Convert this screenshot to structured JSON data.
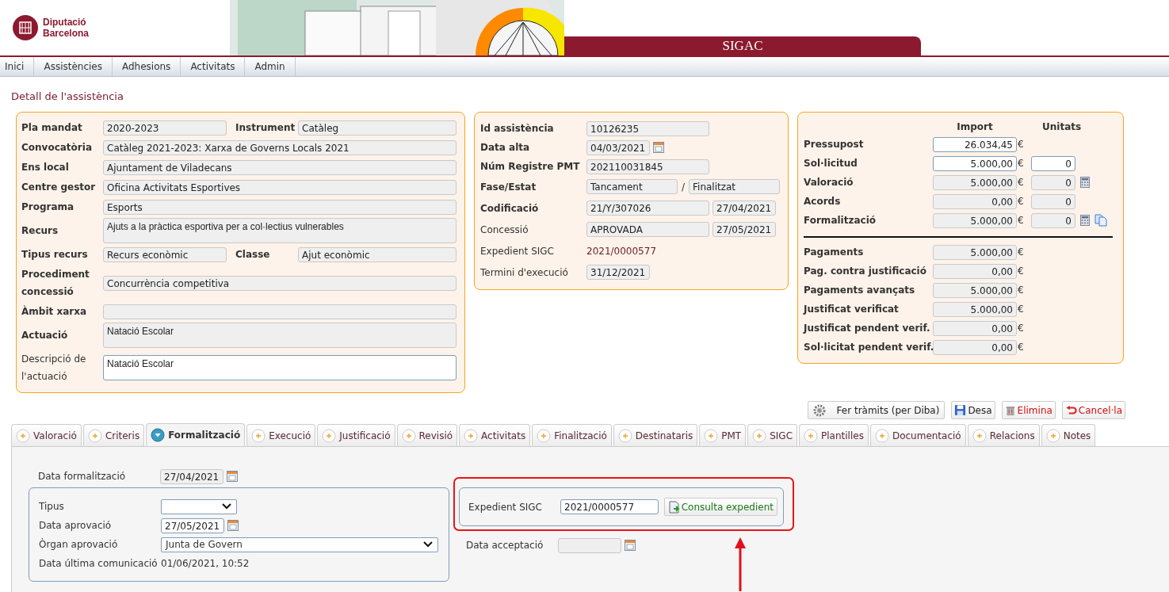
{
  "header": {
    "logo_lines": [
      "Diputació",
      "Barcelona"
    ],
    "app_title": "SIGAC"
  },
  "nav": [
    {
      "label": "Inici"
    },
    {
      "label": "Assistències"
    },
    {
      "label": "Adhesions"
    },
    {
      "label": "Activitats"
    },
    {
      "label": "Admin"
    }
  ],
  "page_title": "Detall de l'assistència",
  "general": [
    {
      "kind": "pair",
      "label": "Pla mandat",
      "bold": true,
      "value": "2020-2023",
      "label2": "Instrument",
      "value2": "Catàleg"
    },
    {
      "kind": "single",
      "label": "Convocatòria",
      "bold": true,
      "value": "Catàleg 2021-2023: Xarxa de Governs Locals 2021",
      "editable": false
    },
    {
      "kind": "single",
      "label": "Ens local",
      "bold": true,
      "value": "Ajuntament de Viladecans",
      "editable": false
    },
    {
      "kind": "single",
      "label": "Centre gestor",
      "bold": true,
      "value": "Oficina Activitats Esportives",
      "editable": false
    },
    {
      "kind": "single",
      "label": "Programa",
      "bold": true,
      "value": "Esports",
      "editable": false
    },
    {
      "kind": "textarea",
      "label": "Recurs",
      "bold": true,
      "value": "Ajuts a la pràctica esportiva per a col·lectius vulnerables",
      "editable": false
    },
    {
      "kind": "pair",
      "label": "Tipus recurs",
      "bold": true,
      "value": "Recurs econòmic",
      "label2": "Classe",
      "value2": "Ajut econòmic"
    },
    {
      "kind": "single",
      "label": "Procediment concessió",
      "bold": true,
      "value": "Concurrència competitiva",
      "editable": false
    },
    {
      "kind": "single",
      "label": "Àmbit xarxa",
      "bold": true,
      "editable": false
    },
    {
      "kind": "textarea",
      "label": "Actuació",
      "bold": true,
      "value": "Natació Escolar",
      "editable": false
    },
    {
      "kind": "textarea",
      "label": "Descripció de l'actuació",
      "bold": false,
      "value": "Natació Escolar",
      "editable": true
    }
  ],
  "identification": [
    {
      "kind": "field",
      "label": "Id assistència",
      "bold": true,
      "value": "10126235"
    },
    {
      "kind": "date",
      "label": "Data alta",
      "bold": true,
      "value": "04/03/2021"
    },
    {
      "kind": "field",
      "label": "Núm Registre PMT",
      "bold": true,
      "value": "202110031845"
    },
    {
      "kind": "slash",
      "label": "Fase/Estat",
      "bold": true,
      "value": "Tancament",
      "separator": "/",
      "value2": "Finalitzat"
    },
    {
      "kind": "pair",
      "label": "Codificació",
      "bold": true,
      "value": "21/Y/307026",
      "value2": "27/04/2021"
    },
    {
      "kind": "pair",
      "label": "Concessió",
      "bold": false,
      "value": "APROVADA",
      "value2": "27/05/2021"
    },
    {
      "kind": "text",
      "label": "Expedient SIGC",
      "bold": false,
      "value": "2021/0000577"
    },
    {
      "kind": "short",
      "label": "Termini d'execució",
      "bold": false,
      "value": "31/12/2021"
    }
  ],
  "amounts": {
    "headers": [
      "Import",
      "Unitats"
    ],
    "currency": "€",
    "rows": [
      {
        "label": "Pressupost",
        "import": "26.034,45",
        "import_editable": true
      },
      {
        "label": "Sol·licitud",
        "import": "5.000,00",
        "import_editable": true,
        "units": "0",
        "units_editable": true
      },
      {
        "label": "Valoració",
        "import": "5.000,00",
        "import_editable": false,
        "units": "0",
        "units_editable": false,
        "calculator": true
      },
      {
        "label": "Acords",
        "import": "0,00",
        "import_editable": false,
        "units": "0",
        "units_editable": false
      },
      {
        "label": "Formalització",
        "import": "5.000,00",
        "import_editable": false,
        "units": "0",
        "units_editable": false,
        "calculator": true,
        "copy": true
      }
    ],
    "payments": [
      {
        "label": "Pagaments",
        "import": "5.000,00"
      },
      {
        "label": "Pag. contra justificació",
        "import": "0,00"
      },
      {
        "label": "Pagaments avançats",
        "import": "5.000,00"
      },
      {
        "label": "Justificat verificat",
        "import": "5.000,00"
      },
      {
        "label": "Justificat pendent verif.",
        "import": "0,00"
      },
      {
        "label": "Sol·licitat pendent verif.",
        "import": "0,00"
      }
    ]
  },
  "actions": [
    {
      "label": "Fer tràmits (per Diba)",
      "kind": "process"
    },
    {
      "label": "Desa",
      "kind": "save"
    },
    {
      "label": "Elimina",
      "kind": "delete"
    },
    {
      "label": "Cancel·la",
      "kind": "cancel"
    }
  ],
  "tabs": [
    {
      "label": "Valoració",
      "selected": false
    },
    {
      "label": "Criteris",
      "selected": false
    },
    {
      "label": "Formalització",
      "selected": true
    },
    {
      "label": "Execució",
      "selected": false
    },
    {
      "label": "Justificació",
      "selected": false
    },
    {
      "label": "Revisió",
      "selected": false
    },
    {
      "label": "Activitats",
      "selected": false
    },
    {
      "label": "Finalització",
      "selected": false
    },
    {
      "label": "Destinataris",
      "selected": false
    },
    {
      "label": "PMT",
      "selected": false
    },
    {
      "label": "SIGC",
      "selected": false
    },
    {
      "label": "Plantilles",
      "selected": false
    },
    {
      "label": "Documentació",
      "selected": false
    },
    {
      "label": "Relacions",
      "selected": false
    },
    {
      "label": "Notes",
      "selected": false
    }
  ],
  "formalitzacio": {
    "data_formalitzacio": {
      "label": "Data formalització",
      "value": "27/04/2021"
    },
    "tipus": {
      "label": "Tipus"
    },
    "data_aprovacio": {
      "label": "Data aprovació",
      "value": "27/05/2021"
    },
    "organ_aprovacio": {
      "label": "Òrgan aprovació",
      "value": "Junta de Govern"
    },
    "data_ultima_comunicacio": {
      "label": "Data última comunicació",
      "value": "01/06/2021, 10:52"
    },
    "expedient_sigc": {
      "label": "Expedient SIGC",
      "value": "2021/0000577",
      "button": "Consulta expedient",
      "highlighted": true
    },
    "data_acceptacio": {
      "label": "Data acceptació"
    }
  }
}
